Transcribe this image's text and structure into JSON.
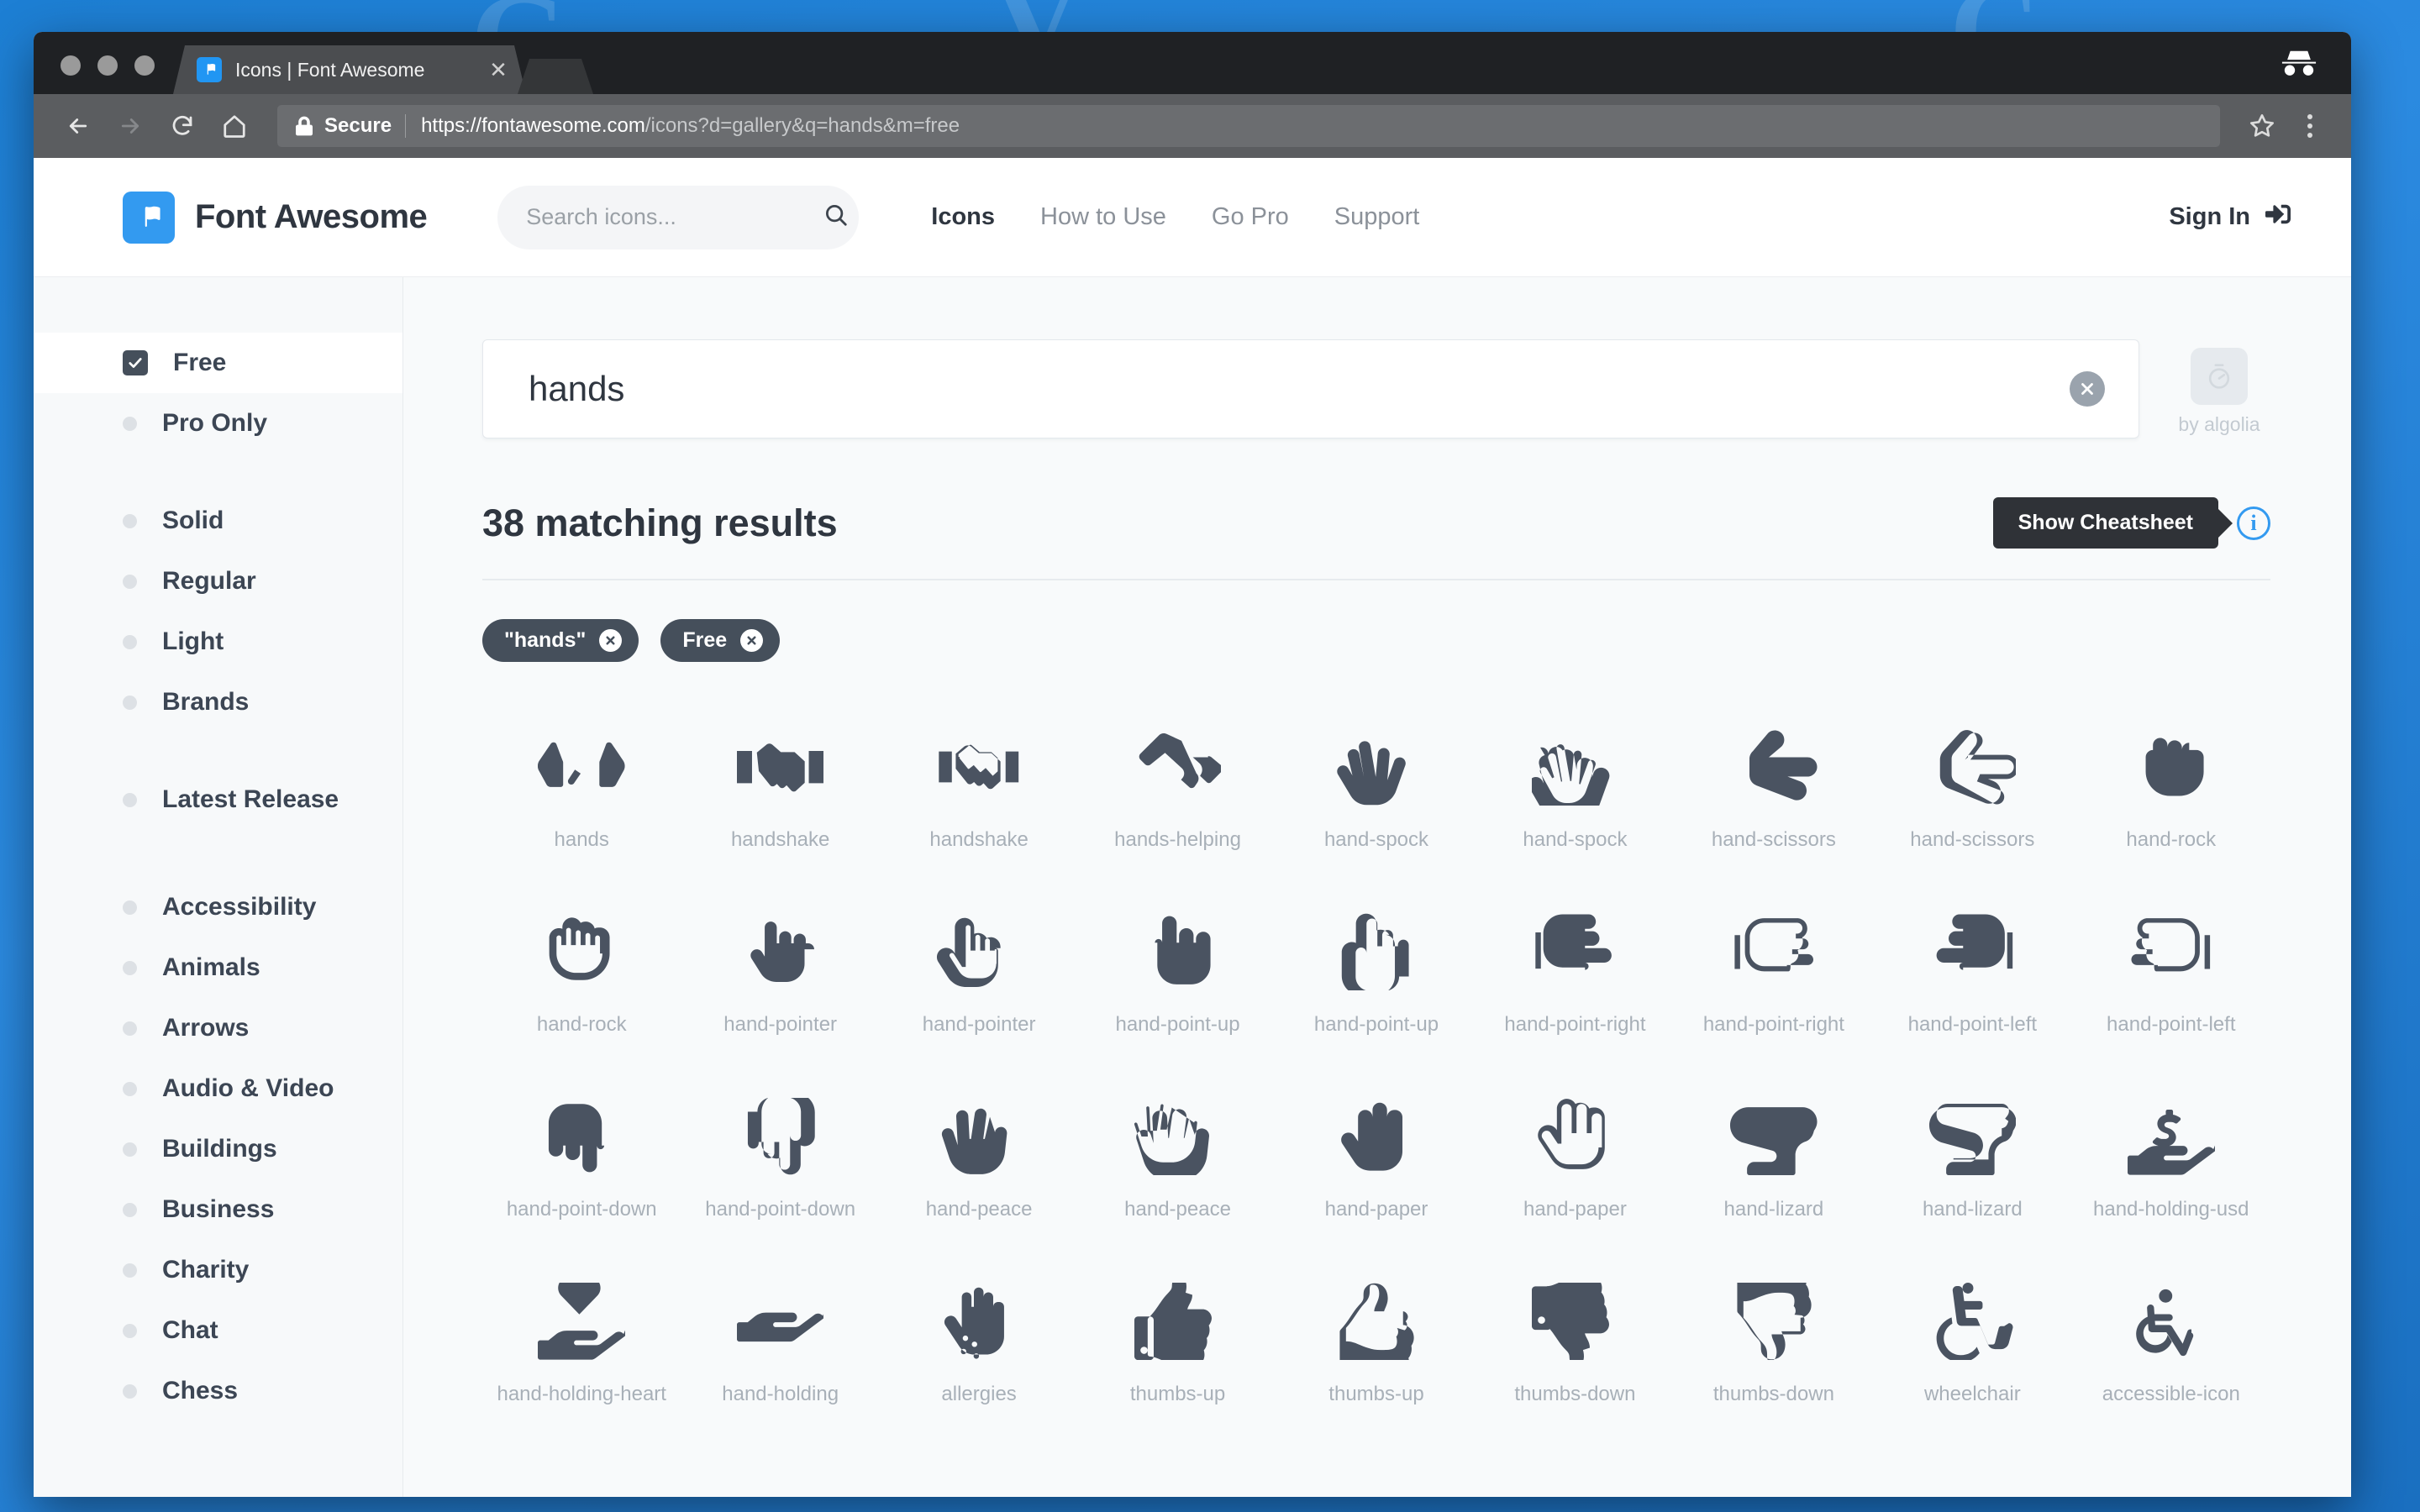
{
  "browser": {
    "tab_title": "Icons | Font Awesome",
    "tab_close_label": "✕",
    "secure_label": "Secure",
    "url_domain": "https://fontawesome.com",
    "url_path": "/icons?d=gallery&q=hands&m=free",
    "back_icon": "back-arrow-icon",
    "forward_icon": "forward-arrow-icon",
    "reload_icon": "reload-icon",
    "home_icon": "home-icon",
    "bookmark_icon": "star-icon",
    "menu_icon": "three-dot-menu-icon",
    "incognito_icon": "incognito-icon"
  },
  "header": {
    "brand_name": "Font Awesome",
    "search_placeholder": "Search icons...",
    "search_value": "",
    "nav": [
      {
        "label": "Icons",
        "active": true
      },
      {
        "label": "How to Use",
        "active": false
      },
      {
        "label": "Go Pro",
        "active": false
      },
      {
        "label": "Support",
        "active": false
      }
    ],
    "sign_in_label": "Sign In"
  },
  "sidebar": {
    "license": [
      {
        "label": "Free",
        "type": "checkbox",
        "checked": true
      },
      {
        "label": "Pro Only",
        "type": "bullet",
        "checked": false
      }
    ],
    "styles": [
      {
        "label": "Solid",
        "type": "bullet"
      },
      {
        "label": "Regular",
        "type": "bullet"
      },
      {
        "label": "Light",
        "type": "bullet"
      },
      {
        "label": "Brands",
        "type": "bullet"
      }
    ],
    "release": [
      {
        "label": "Latest Release",
        "type": "bullet"
      }
    ],
    "categories": [
      {
        "label": "Accessibility",
        "type": "bullet"
      },
      {
        "label": "Animals",
        "type": "bullet"
      },
      {
        "label": "Arrows",
        "type": "bullet"
      },
      {
        "label": "Audio & Video",
        "type": "bullet"
      },
      {
        "label": "Buildings",
        "type": "bullet"
      },
      {
        "label": "Business",
        "type": "bullet"
      },
      {
        "label": "Charity",
        "type": "bullet"
      },
      {
        "label": "Chat",
        "type": "bullet"
      },
      {
        "label": "Chess",
        "type": "bullet"
      }
    ]
  },
  "main": {
    "search_value": "hands",
    "search_placeholder": "Search icons...",
    "clear_label": "✕",
    "algolia_label": "by algolia",
    "results_count_label": "38 matching results",
    "cheatsheet_label": "Show Cheatsheet",
    "info_label": "i",
    "tags": [
      {
        "label": "\"hands\"",
        "close": "✕"
      },
      {
        "label": "Free",
        "close": "✕"
      }
    ],
    "icons": [
      {
        "name": "hands",
        "glyph": "hands"
      },
      {
        "name": "handshake",
        "glyph": "handshake-solid"
      },
      {
        "name": "handshake",
        "glyph": "handshake-regular"
      },
      {
        "name": "hands-helping",
        "glyph": "hands-helping"
      },
      {
        "name": "hand-spock",
        "glyph": "hand-spock-solid"
      },
      {
        "name": "hand-spock",
        "glyph": "hand-spock-regular"
      },
      {
        "name": "hand-scissors",
        "glyph": "hand-scissors-solid"
      },
      {
        "name": "hand-scissors",
        "glyph": "hand-scissors-regular"
      },
      {
        "name": "hand-rock",
        "glyph": "hand-rock-solid"
      },
      {
        "name": "hand-rock",
        "glyph": "hand-rock-regular"
      },
      {
        "name": "hand-pointer",
        "glyph": "hand-pointer-solid"
      },
      {
        "name": "hand-pointer",
        "glyph": "hand-pointer-regular"
      },
      {
        "name": "hand-point-up",
        "glyph": "hand-point-up-solid"
      },
      {
        "name": "hand-point-up",
        "glyph": "hand-point-up-regular"
      },
      {
        "name": "hand-point-right",
        "glyph": "hand-point-right-solid"
      },
      {
        "name": "hand-point-right",
        "glyph": "hand-point-right-regular"
      },
      {
        "name": "hand-point-left",
        "glyph": "hand-point-left-solid"
      },
      {
        "name": "hand-point-left",
        "glyph": "hand-point-left-regular"
      },
      {
        "name": "hand-point-down",
        "glyph": "hand-point-down-solid"
      },
      {
        "name": "hand-point-down",
        "glyph": "hand-point-down-regular"
      },
      {
        "name": "hand-peace",
        "glyph": "hand-peace-solid"
      },
      {
        "name": "hand-peace",
        "glyph": "hand-peace-regular"
      },
      {
        "name": "hand-paper",
        "glyph": "hand-paper-solid"
      },
      {
        "name": "hand-paper",
        "glyph": "hand-paper-regular"
      },
      {
        "name": "hand-lizard",
        "glyph": "hand-lizard-solid"
      },
      {
        "name": "hand-lizard",
        "glyph": "hand-lizard-regular"
      },
      {
        "name": "hand-holding-usd",
        "glyph": "hand-holding-usd"
      },
      {
        "name": "hand-holding-heart",
        "glyph": "hand-holding-heart"
      },
      {
        "name": "hand-holding",
        "glyph": "hand-holding"
      },
      {
        "name": "allergies",
        "glyph": "allergies"
      },
      {
        "name": "thumbs-up",
        "glyph": "thumbs-up-solid"
      },
      {
        "name": "thumbs-up",
        "glyph": "thumbs-up-regular"
      },
      {
        "name": "thumbs-down",
        "glyph": "thumbs-down-solid"
      },
      {
        "name": "thumbs-down",
        "glyph": "thumbs-down-regular"
      },
      {
        "name": "wheelchair",
        "glyph": "wheelchair"
      },
      {
        "name": "accessible-icon",
        "glyph": "accessible-icon"
      }
    ]
  },
  "colors": {
    "brand_blue": "#339af0",
    "dark": "#2f3640",
    "icon_gray": "#4a5361",
    "caption_gray": "#a8b0b8",
    "desktop_blue": "#2b8ae0"
  }
}
